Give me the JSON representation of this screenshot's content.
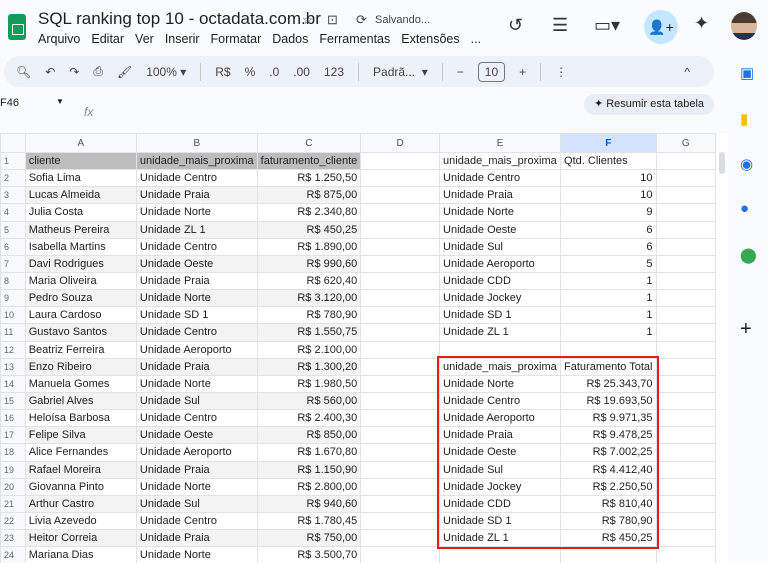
{
  "header": {
    "title": "SQL ranking top 10 - octadata.com.br",
    "status": "Salvando...",
    "menu": [
      "Arquivo",
      "Editar",
      "Ver",
      "Inserir",
      "Formatar",
      "Dados",
      "Ferramentas",
      "Extensões",
      "..."
    ]
  },
  "toolbar": {
    "zoom": "100%",
    "currency": "R$",
    "percent": "%",
    "dec_less": ".0",
    "dec_more": ".00",
    "format123": "123",
    "font": "Padrã...",
    "font_size": "10"
  },
  "formula": {
    "cell": "F46",
    "fx": "fx",
    "summarize": "Resumir esta tabela"
  },
  "columns": [
    "A",
    "B",
    "C",
    "D",
    "E",
    "F",
    "G"
  ],
  "selected_column": "F",
  "sheet": {
    "left_header": [
      "cliente",
      "unidade_mais_proxima",
      "faturamento_cliente"
    ],
    "left_rows": [
      [
        "Sofia Lima",
        "Unidade Centro",
        "R$ 1.250,50"
      ],
      [
        "Lucas Almeida",
        "Unidade Praia",
        "R$ 875,00"
      ],
      [
        "Julia Costa",
        "Unidade Norte",
        "R$ 2.340,80"
      ],
      [
        "Matheus Pereira",
        "Unidade ZL 1",
        "R$ 450,25"
      ],
      [
        "Isabella Martins",
        "Unidade Centro",
        "R$ 1.890,00"
      ],
      [
        "Davi Rodrigues",
        "Unidade Oeste",
        "R$ 990,60"
      ],
      [
        "Maria Oliveira",
        "Unidade Praia",
        "R$ 620,40"
      ],
      [
        "Pedro Souza",
        "Unidade Norte",
        "R$ 3.120,00"
      ],
      [
        "Laura Cardoso",
        "Unidade SD 1",
        "R$ 780,90"
      ],
      [
        "Gustavo Santos",
        "Unidade Centro",
        "R$ 1.550,75"
      ],
      [
        "Beatriz Ferreira",
        "Unidade Aeroporto",
        "R$ 2.100,00"
      ],
      [
        "Enzo Ribeiro",
        "Unidade Praia",
        "R$ 1.300,20"
      ],
      [
        "Manuela Gomes",
        "Unidade Norte",
        "R$ 1.980,50"
      ],
      [
        "Gabriel Alves",
        "Unidade Sul",
        "R$ 560,00"
      ],
      [
        "Heloísa Barbosa",
        "Unidade Centro",
        "R$ 2.400,30"
      ],
      [
        "Felipe Silva",
        "Unidade Oeste",
        "R$ 850,00"
      ],
      [
        "Alice Fernandes",
        "Unidade Aeroporto",
        "R$ 1.670,80"
      ],
      [
        "Rafael Moreira",
        "Unidade Praia",
        "R$ 1.150,90"
      ],
      [
        "Giovanna Pinto",
        "Unidade Norte",
        "R$ 2.800,00"
      ],
      [
        "Arthur Castro",
        "Unidade Sul",
        "R$ 940,60"
      ],
      [
        "Livia Azevedo",
        "Unidade Centro",
        "R$ 1.780,45"
      ],
      [
        "Heitor Correia",
        "Unidade Praia",
        "R$ 750,00"
      ],
      [
        "Mariana Dias",
        "Unidade Norte",
        "R$ 3.500,70"
      ]
    ],
    "count_header": [
      "unidade_mais_proxima",
      "Qtd. Clientes"
    ],
    "count_rows": [
      [
        "Unidade Centro",
        "10"
      ],
      [
        "Unidade Praia",
        "10"
      ],
      [
        "Unidade Norte",
        "9"
      ],
      [
        "Unidade Oeste",
        "6"
      ],
      [
        "Unidade Sul",
        "6"
      ],
      [
        "Unidade Aeroporto",
        "5"
      ],
      [
        "Unidade CDD",
        "1"
      ],
      [
        "Unidade Jockey",
        "1"
      ],
      [
        "Unidade SD 1",
        "1"
      ],
      [
        "Unidade ZL 1",
        "1"
      ]
    ],
    "revenue_header": [
      "unidade_mais_proxima",
      "Faturamento Total"
    ],
    "revenue_rows": [
      [
        "Unidade Norte",
        "R$ 25.343,70"
      ],
      [
        "Unidade Centro",
        "R$ 19.693,50"
      ],
      [
        "Unidade Aeroporto",
        "R$ 9.971,35"
      ],
      [
        "Unidade Praia",
        "R$ 9.478,25"
      ],
      [
        "Unidade Oeste",
        "R$ 7.002,25"
      ],
      [
        "Unidade Sul",
        "R$ 4.412,40"
      ],
      [
        "Unidade Jockey",
        "R$ 2.250,50"
      ],
      [
        "Unidade CDD",
        "R$ 810,40"
      ],
      [
        "Unidade SD 1",
        "R$ 780,90"
      ],
      [
        "Unidade ZL 1",
        "R$ 450,25"
      ]
    ]
  },
  "colors": {
    "highlight_border": "#e01f1f",
    "header_fill": "#bdbdbd",
    "selected_col": "#d3e3fd"
  }
}
